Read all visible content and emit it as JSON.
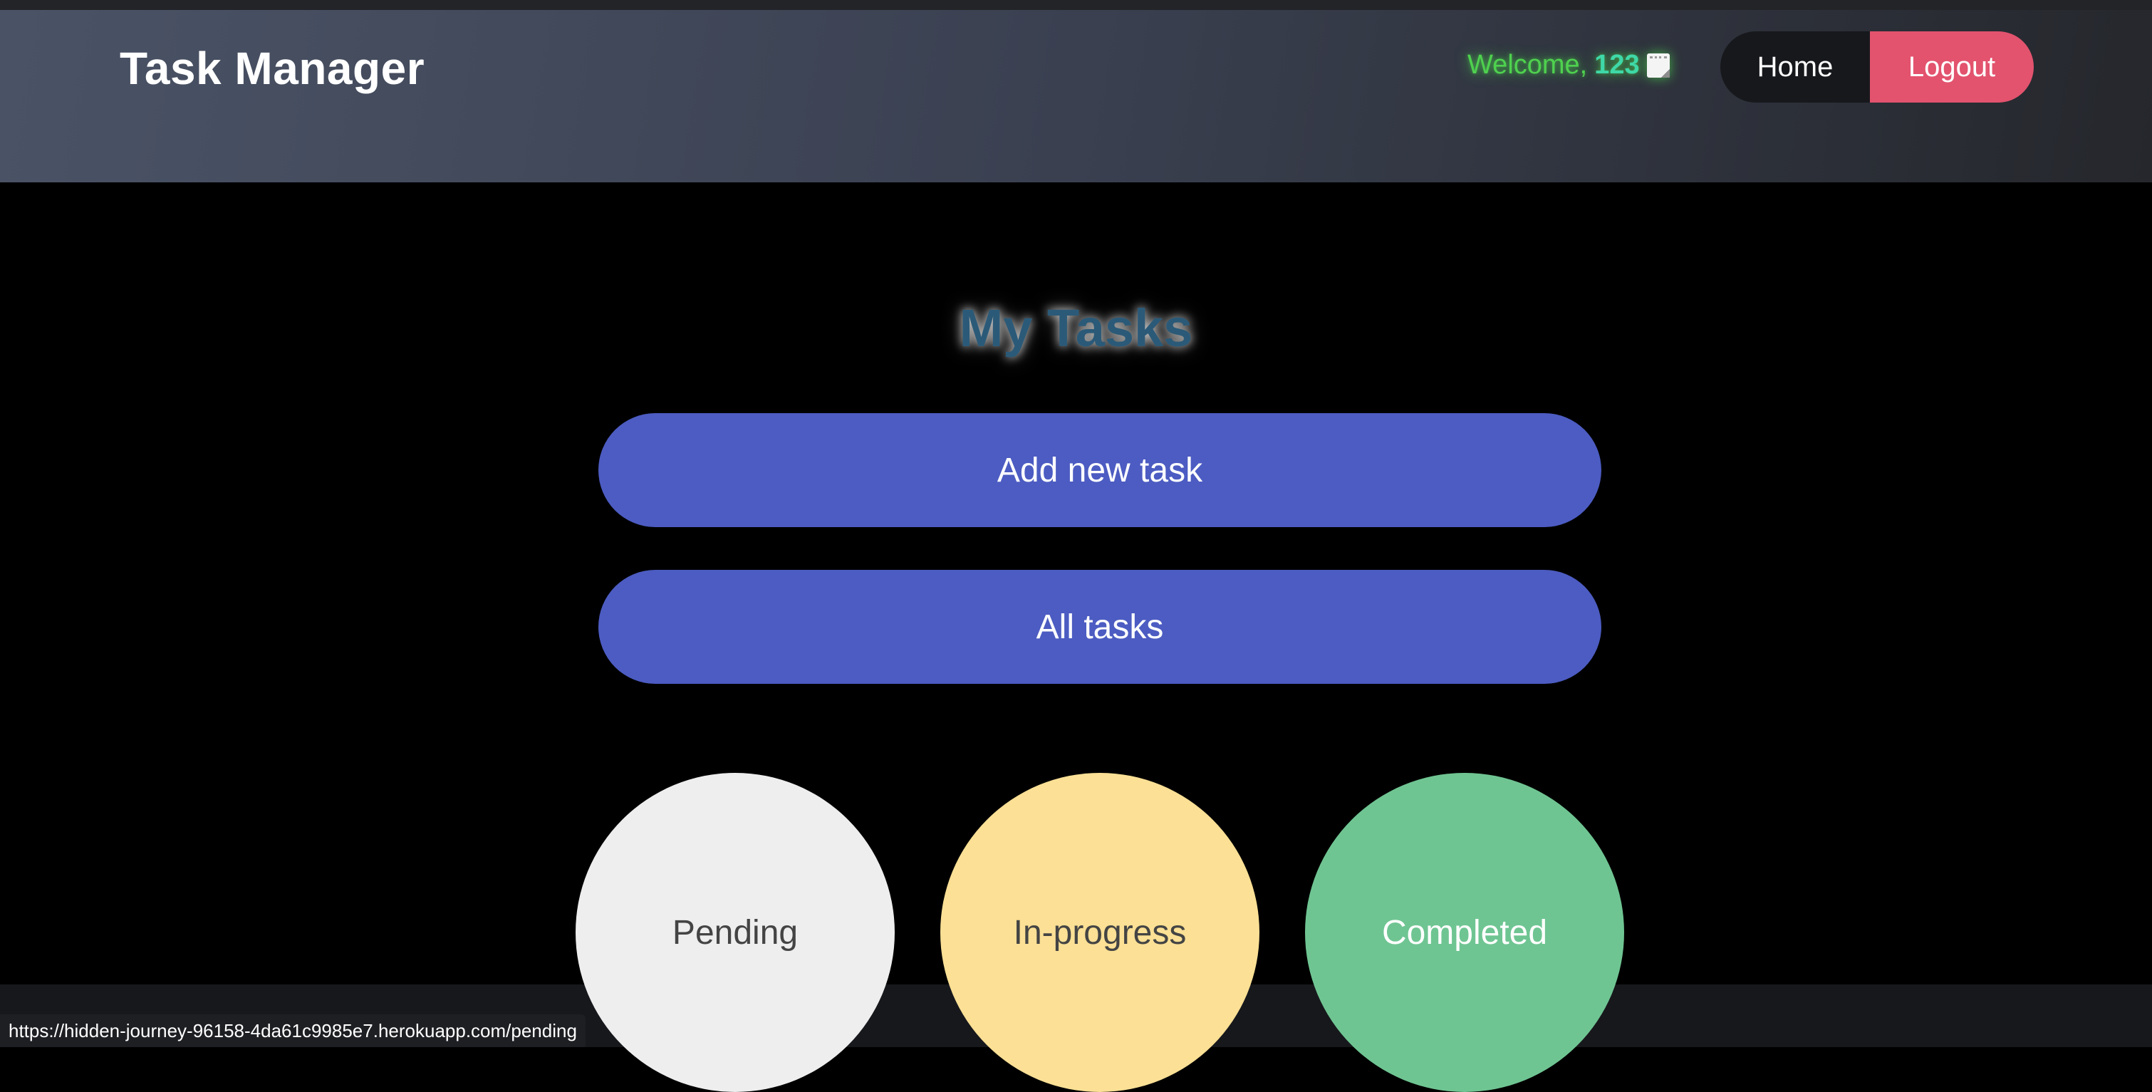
{
  "header": {
    "brand": "Task Manager",
    "welcome_label": "Welcome,",
    "username": "123",
    "note_icon": "memo-icon",
    "nav": {
      "home_label": "Home",
      "logout_label": "Logout"
    }
  },
  "main": {
    "title": "My Tasks",
    "add_task_label": "Add new task",
    "all_tasks_label": "All tasks",
    "status_filters": [
      {
        "label": "Pending",
        "color": "#eeeeee"
      },
      {
        "label": "In-progress",
        "color": "#fbe095"
      },
      {
        "label": "Completed",
        "color": "#6fc592"
      }
    ]
  },
  "statusbar": {
    "url": "https://hidden-journey-96158-4da61c9985e7.herokuapp.com/pending"
  },
  "colors": {
    "primary_button": "#4c5cc2",
    "logout": "#e3536e",
    "welcome": "#4fd14f"
  }
}
